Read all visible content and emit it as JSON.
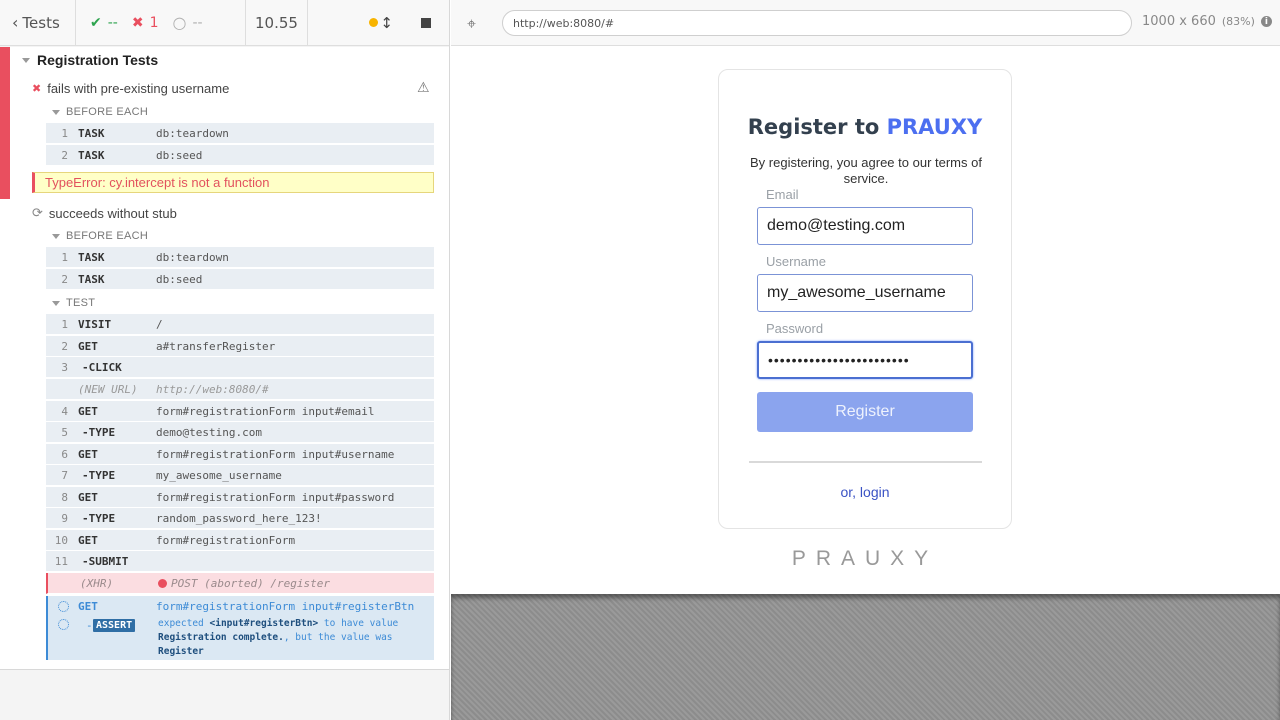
{
  "reporter": {
    "header": {
      "back_label": "Tests",
      "passed": "--",
      "failed": "1",
      "pending": "--",
      "duration": "10.55"
    },
    "suite_title": "Registration Tests",
    "test1": {
      "title": "fails with pre-existing username",
      "before_each_label": "BEFORE EACH",
      "commands": [
        {
          "num": "1",
          "name": "TASK",
          "msg": "db:teardown"
        },
        {
          "num": "2",
          "name": "TASK",
          "msg": "db:seed"
        }
      ],
      "error": "TypeError: cy.intercept is not a function"
    },
    "test2": {
      "title": "succeeds without stub",
      "before_each_label": "BEFORE EACH",
      "before_commands": [
        {
          "num": "1",
          "name": "TASK",
          "msg": "db:teardown"
        },
        {
          "num": "2",
          "name": "TASK",
          "msg": "db:seed"
        }
      ],
      "test_label": "TEST",
      "commands": [
        {
          "num": "1",
          "name": "VISIT",
          "msg": "/"
        },
        {
          "num": "2",
          "name": "GET",
          "msg": "a#transferRegister"
        },
        {
          "num": "3",
          "name": "-CLICK",
          "msg": ""
        },
        {
          "num": "",
          "name": "(NEW URL)",
          "msg": "http://web:8080/#"
        },
        {
          "num": "4",
          "name": "GET",
          "msg": "form#registrationForm input#email"
        },
        {
          "num": "5",
          "name": "-TYPE",
          "msg": "demo@testing.com"
        },
        {
          "num": "6",
          "name": "GET",
          "msg": "form#registrationForm input#username"
        },
        {
          "num": "7",
          "name": "-TYPE",
          "msg": "my_awesome_username"
        },
        {
          "num": "8",
          "name": "GET",
          "msg": "form#registrationForm input#password"
        },
        {
          "num": "9",
          "name": "-TYPE",
          "msg": "random_password_here_123!"
        },
        {
          "num": "10",
          "name": "GET",
          "msg": "form#registrationForm"
        },
        {
          "num": "11",
          "name": "-SUBMIT",
          "msg": ""
        }
      ],
      "xhr": {
        "name": "(XHR)",
        "msg": "POST (aborted) /register"
      },
      "pending_get": {
        "name": "GET",
        "msg": "form#registrationForm input#registerBtn"
      },
      "assert": {
        "badge": "ASSERT",
        "expected": "expected",
        "subject": "<input#registerBtn>",
        "to_have": "to have value",
        "value": "Registration complete.",
        "but": ", but the value was",
        "actual": "Register"
      }
    }
  },
  "runner": {
    "url": "http://web:8080/#",
    "viewport": "1000 x 660",
    "scale": "(83%)"
  },
  "app": {
    "title_prefix": "Register to",
    "title_brand": "PRAUXY",
    "terms": "By registering, you agree to our terms of service.",
    "email_label": "Email",
    "email_value": "demo@testing.com",
    "username_label": "Username",
    "username_value": "my_awesome_username",
    "password_label": "Password",
    "password_value": "••••••••••••••••••••••••",
    "register_button": "Register",
    "login_link": "or, login",
    "logo_text": "PRAUXY"
  },
  "colors": {
    "fail": "#e94f5f",
    "pass": "#2ea44f",
    "brand": "#4c6ff0",
    "assert_blue": "#3d8bd6"
  }
}
